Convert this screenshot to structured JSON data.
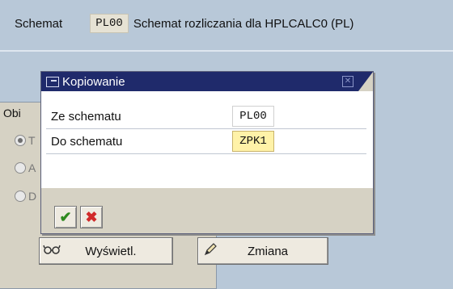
{
  "main": {
    "schema_label": "Schemat",
    "schema_code": "PL00",
    "schema_description": "Schemat rozliczania dla HPLCALC0 (PL)",
    "group_title": "Obi",
    "radios": [
      {
        "label": "T",
        "selected": true
      },
      {
        "label": "A",
        "selected": false
      },
      {
        "label": "D",
        "selected": false
      }
    ],
    "display_button": {
      "label": "Wyświetl.",
      "icon": "glasses-icon"
    },
    "change_button": {
      "label": "Zmiana",
      "icon": "pencil-icon"
    }
  },
  "dialog": {
    "title": "Kopiowanie",
    "title_icon": "dialog-window-icon",
    "fields": [
      {
        "label": "Ze schematu",
        "value": "PL00",
        "editable": false
      },
      {
        "label": "Do schematu",
        "value": "ZPK1",
        "editable": true
      }
    ],
    "buttons": {
      "ok": {
        "glyph": "✔",
        "icon": "checkmark-icon",
        "color": "#2f8a1f"
      },
      "cancel": {
        "glyph": "✖",
        "icon": "cancel-icon",
        "color": "#d12a2a"
      }
    }
  }
}
